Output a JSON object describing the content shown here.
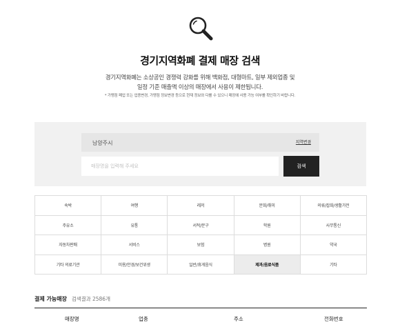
{
  "header": {
    "icon": "search-icon",
    "title": "경기지역화폐 결제 매장 검색",
    "description_line1": "경기지역화폐는 소상공인 경쟁력 강화를 위해 백화점, 대형마트, 일부 제외업종 및",
    "description_line2": "일정 기준 매출액 이상의 매장에서 사용이 제한됩니다.",
    "note": "* 가맹점 폐업 또는 업종변경, 가맹점 정보변경 등으로 현재 정보와 다를 수 있으니 매장에 사용 가능 여부를 확인하기 바랍니다."
  },
  "search": {
    "region_value": "남양주시",
    "region_change_label": "지역변경",
    "store_placeholder": "매장명을 입력해 주세요",
    "store_value": "",
    "submit_label": "검색"
  },
  "categories": [
    {
      "label": "숙박",
      "selected": false
    },
    {
      "label": "여행",
      "selected": false
    },
    {
      "label": "레저",
      "selected": false
    },
    {
      "label": "문화/취미",
      "selected": false
    },
    {
      "label": "의류/잡화/생활가전",
      "selected": false
    },
    {
      "label": "주유소",
      "selected": false
    },
    {
      "label": "유통",
      "selected": false
    },
    {
      "label": "서적/문구",
      "selected": false
    },
    {
      "label": "학원",
      "selected": false
    },
    {
      "label": "사무통신",
      "selected": false
    },
    {
      "label": "자동차판매",
      "selected": false
    },
    {
      "label": "서비스",
      "selected": false
    },
    {
      "label": "보험",
      "selected": false
    },
    {
      "label": "병원",
      "selected": false
    },
    {
      "label": "약국",
      "selected": false
    },
    {
      "label": "기타 의료기관",
      "selected": false
    },
    {
      "label": "미용/안경/보건위생",
      "selected": false
    },
    {
      "label": "일반/휴게음식",
      "selected": false
    },
    {
      "label": "제과/음료식품",
      "selected": true
    },
    {
      "label": "기타",
      "selected": false
    }
  ],
  "results": {
    "title": "결제 가능매장",
    "count_text": "검색결과 2586개",
    "columns": [
      "매장명",
      "업종",
      "주소",
      "전화번호"
    ]
  }
}
